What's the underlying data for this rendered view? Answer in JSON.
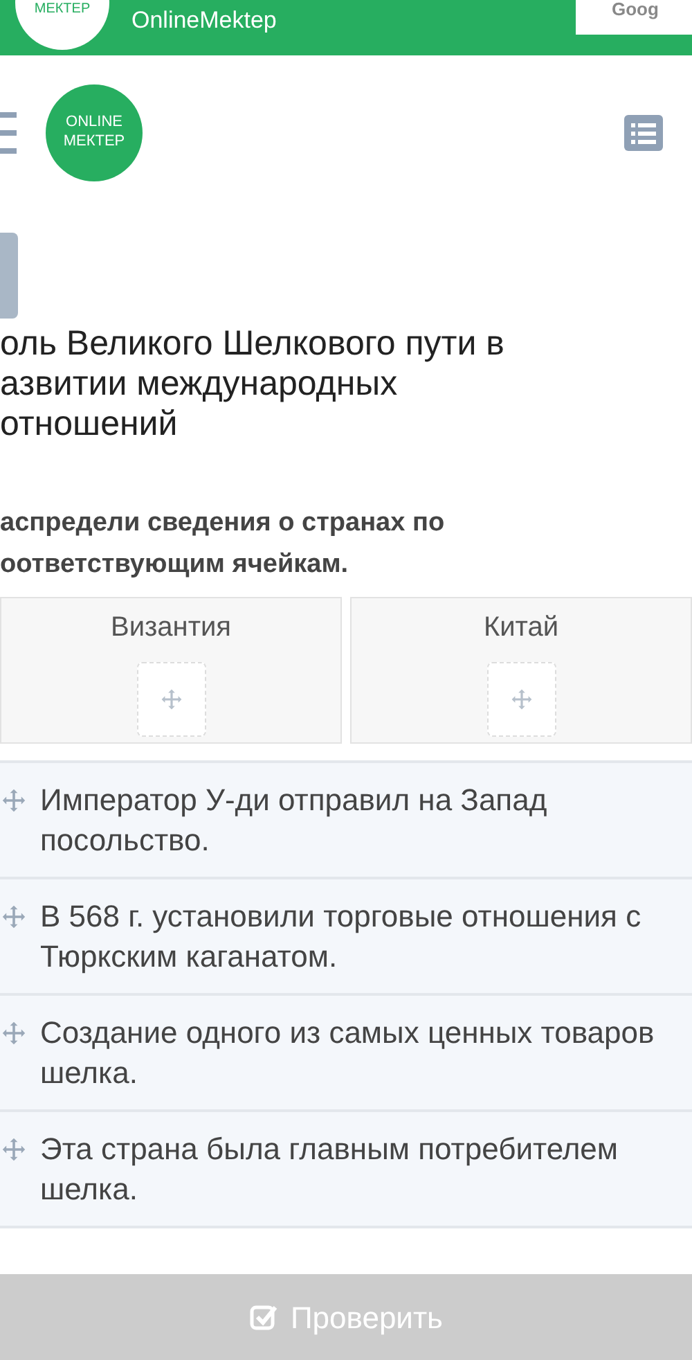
{
  "banner": {
    "logo": "МЕКТЕР",
    "title": "OnlineMektep",
    "store_badge": "Goog"
  },
  "header": {
    "logo_top": "ONLINE",
    "logo_bottom": "МЕКТЕР"
  },
  "title": "оль Великого Шелкового пути в азвитии международных отношений",
  "instruction": "аспредели сведения о странах по оответствующим ячейкам.",
  "drop_zones": [
    {
      "label": "Византия"
    },
    {
      "label": "Китай"
    }
  ],
  "items": [
    {
      "text": "Император У-ди отправил на Запад посольство."
    },
    {
      "text": "В 568 г. установили торговые отношения с Тюркским каганатом."
    },
    {
      "text": "Создание одного из самых ценных товаров шелка."
    },
    {
      "text": "Эта страна была главным потребителем шелка."
    }
  ],
  "check_button": {
    "label": "Проверить",
    "disabled": true
  }
}
